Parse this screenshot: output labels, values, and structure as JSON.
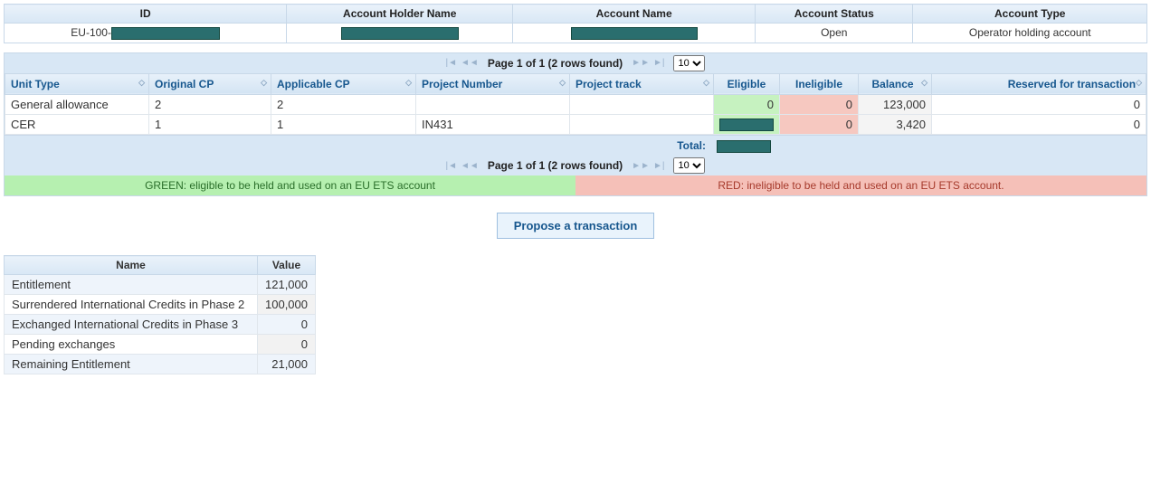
{
  "account_header": {
    "cols": [
      "ID",
      "Account Holder Name",
      "Account Name",
      "Account Status",
      "Account Type"
    ],
    "id_prefix": "EU-100-",
    "status": "Open",
    "type": "Operator holding account"
  },
  "pager": {
    "text": "Page 1 of 1 (2 rows found)",
    "page_size": "10"
  },
  "holdings": {
    "cols": [
      "Unit Type",
      "Original CP",
      "Applicable CP",
      "Project Number",
      "Project track",
      "Eligible",
      "Ineligible",
      "Balance",
      "Reserved for transaction"
    ],
    "rows": [
      {
        "unit_type": "General allowance",
        "original_cp": "2",
        "applicable_cp": "2",
        "project_number": "",
        "project_track": "",
        "eligible": "0",
        "ineligible": "0",
        "balance": "123,000",
        "reserved": "0",
        "eligible_redacted": false
      },
      {
        "unit_type": "CER",
        "original_cp": "1",
        "applicable_cp": "1",
        "project_number": "IN431",
        "project_track": "",
        "eligible": "",
        "ineligible": "0",
        "balance": "3,420",
        "reserved": "0",
        "eligible_redacted": true
      }
    ],
    "total_label": "Total:"
  },
  "legend": {
    "green": "GREEN: eligible to be held and used on an EU ETS account",
    "red": "RED: ineligible to be held and used on an EU ETS account."
  },
  "propose_label": "Propose a transaction",
  "entitlement": {
    "cols": [
      "Name",
      "Value"
    ],
    "rows": [
      {
        "name": "Entitlement",
        "value": "121,000",
        "alt": false
      },
      {
        "name": "Surrendered International Credits in Phase 2",
        "value": "100,000",
        "alt": true
      },
      {
        "name": "Exchanged International Credits in Phase 3",
        "value": "0",
        "alt": false
      },
      {
        "name": "Pending exchanges",
        "value": "0",
        "alt": true
      },
      {
        "name": "Remaining Entitlement",
        "value": "21,000",
        "alt": false
      }
    ]
  }
}
